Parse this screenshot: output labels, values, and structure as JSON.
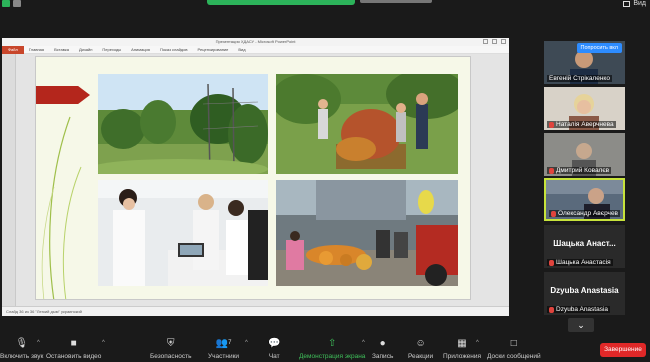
{
  "window": {
    "view_label": "Вид"
  },
  "ppt": {
    "title": "Презентация ХДАСУ - Microsoft PowerPoint",
    "file_tab": "Файл",
    "tabs": [
      "Главная",
      "Вставка",
      "Дизайн",
      "Переходы",
      "Анимация",
      "Показ слайдов",
      "Рецензирование",
      "Вид"
    ],
    "status": "Слайд 36 из 36   \"Легкий дым\"   украинский"
  },
  "participants": [
    {
      "name": "Евгеній Стрікаленко",
      "button": "Попросить вкл",
      "muted": false
    },
    {
      "name": "Наталія Аверчнева",
      "muted": true
    },
    {
      "name": "Дмитрий Ковалєв",
      "muted": true
    },
    {
      "name": "Олександр Авєрчев",
      "muted": true,
      "active": true
    },
    {
      "name": "Шацька Анастасія",
      "big": "Шацька Анаст...",
      "muted": true
    },
    {
      "name": "Dzyuba Anastasia",
      "big": "Dzyuba Anastasia",
      "muted": true
    }
  ],
  "toolbar": {
    "mic": "Включить звук",
    "video": "Остановить видео",
    "security": "Безопасность",
    "participants": "Участники",
    "participants_count": "7",
    "chat": "Чат",
    "share": "Демонстрация экрана",
    "record": "Запись",
    "reactions": "Реакции",
    "apps": "Приложения",
    "whiteboards": "Доски сообщений",
    "end": "Завершение"
  }
}
